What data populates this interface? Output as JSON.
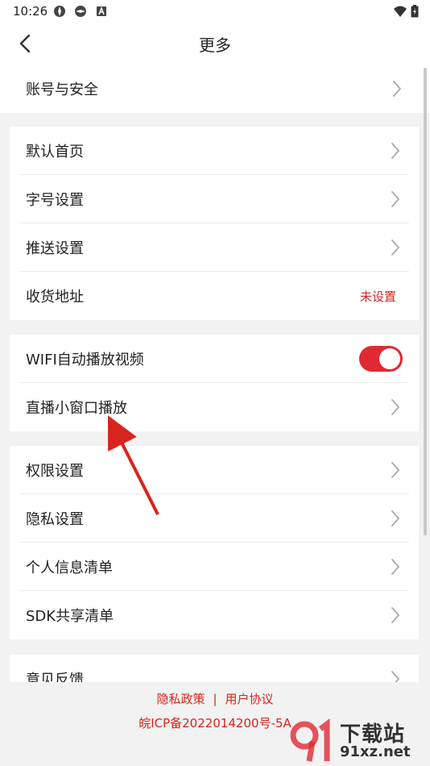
{
  "status_bar": {
    "time": "10:26",
    "icons": [
      "app-icon-1",
      "app-icon-2",
      "a-icon",
      "wifi-icon",
      "battery-icon"
    ]
  },
  "header": {
    "title": "更多",
    "back_icon": "chevron-left-icon"
  },
  "account": {
    "label": "账号与安全"
  },
  "general": {
    "items": [
      {
        "label": "默认首页"
      },
      {
        "label": "字号设置"
      },
      {
        "label": "推送设置"
      },
      {
        "label": "收货地址",
        "value": "未设置"
      }
    ]
  },
  "playback": {
    "items": [
      {
        "label": "WIFI自动播放视频",
        "toggle": true
      },
      {
        "label": "直播小窗口播放"
      }
    ]
  },
  "privacy": {
    "items": [
      {
        "label": "权限设置"
      },
      {
        "label": "隐私设置"
      },
      {
        "label": "个人信息清单"
      },
      {
        "label": "SDK共享清单"
      }
    ]
  },
  "more": {
    "items": [
      {
        "label": "意见反馈"
      }
    ]
  },
  "footer": {
    "privacy_policy": "隐私政策",
    "separator": "|",
    "user_agreement": "用户协议",
    "icp": "皖ICP备2022014200号-5A"
  },
  "watermark": {
    "top": "下载站",
    "bottom": "91xz.net"
  },
  "colors": {
    "accent": "#d9231d",
    "toggle_on": "#e02933",
    "background": "#f2f2f2"
  }
}
